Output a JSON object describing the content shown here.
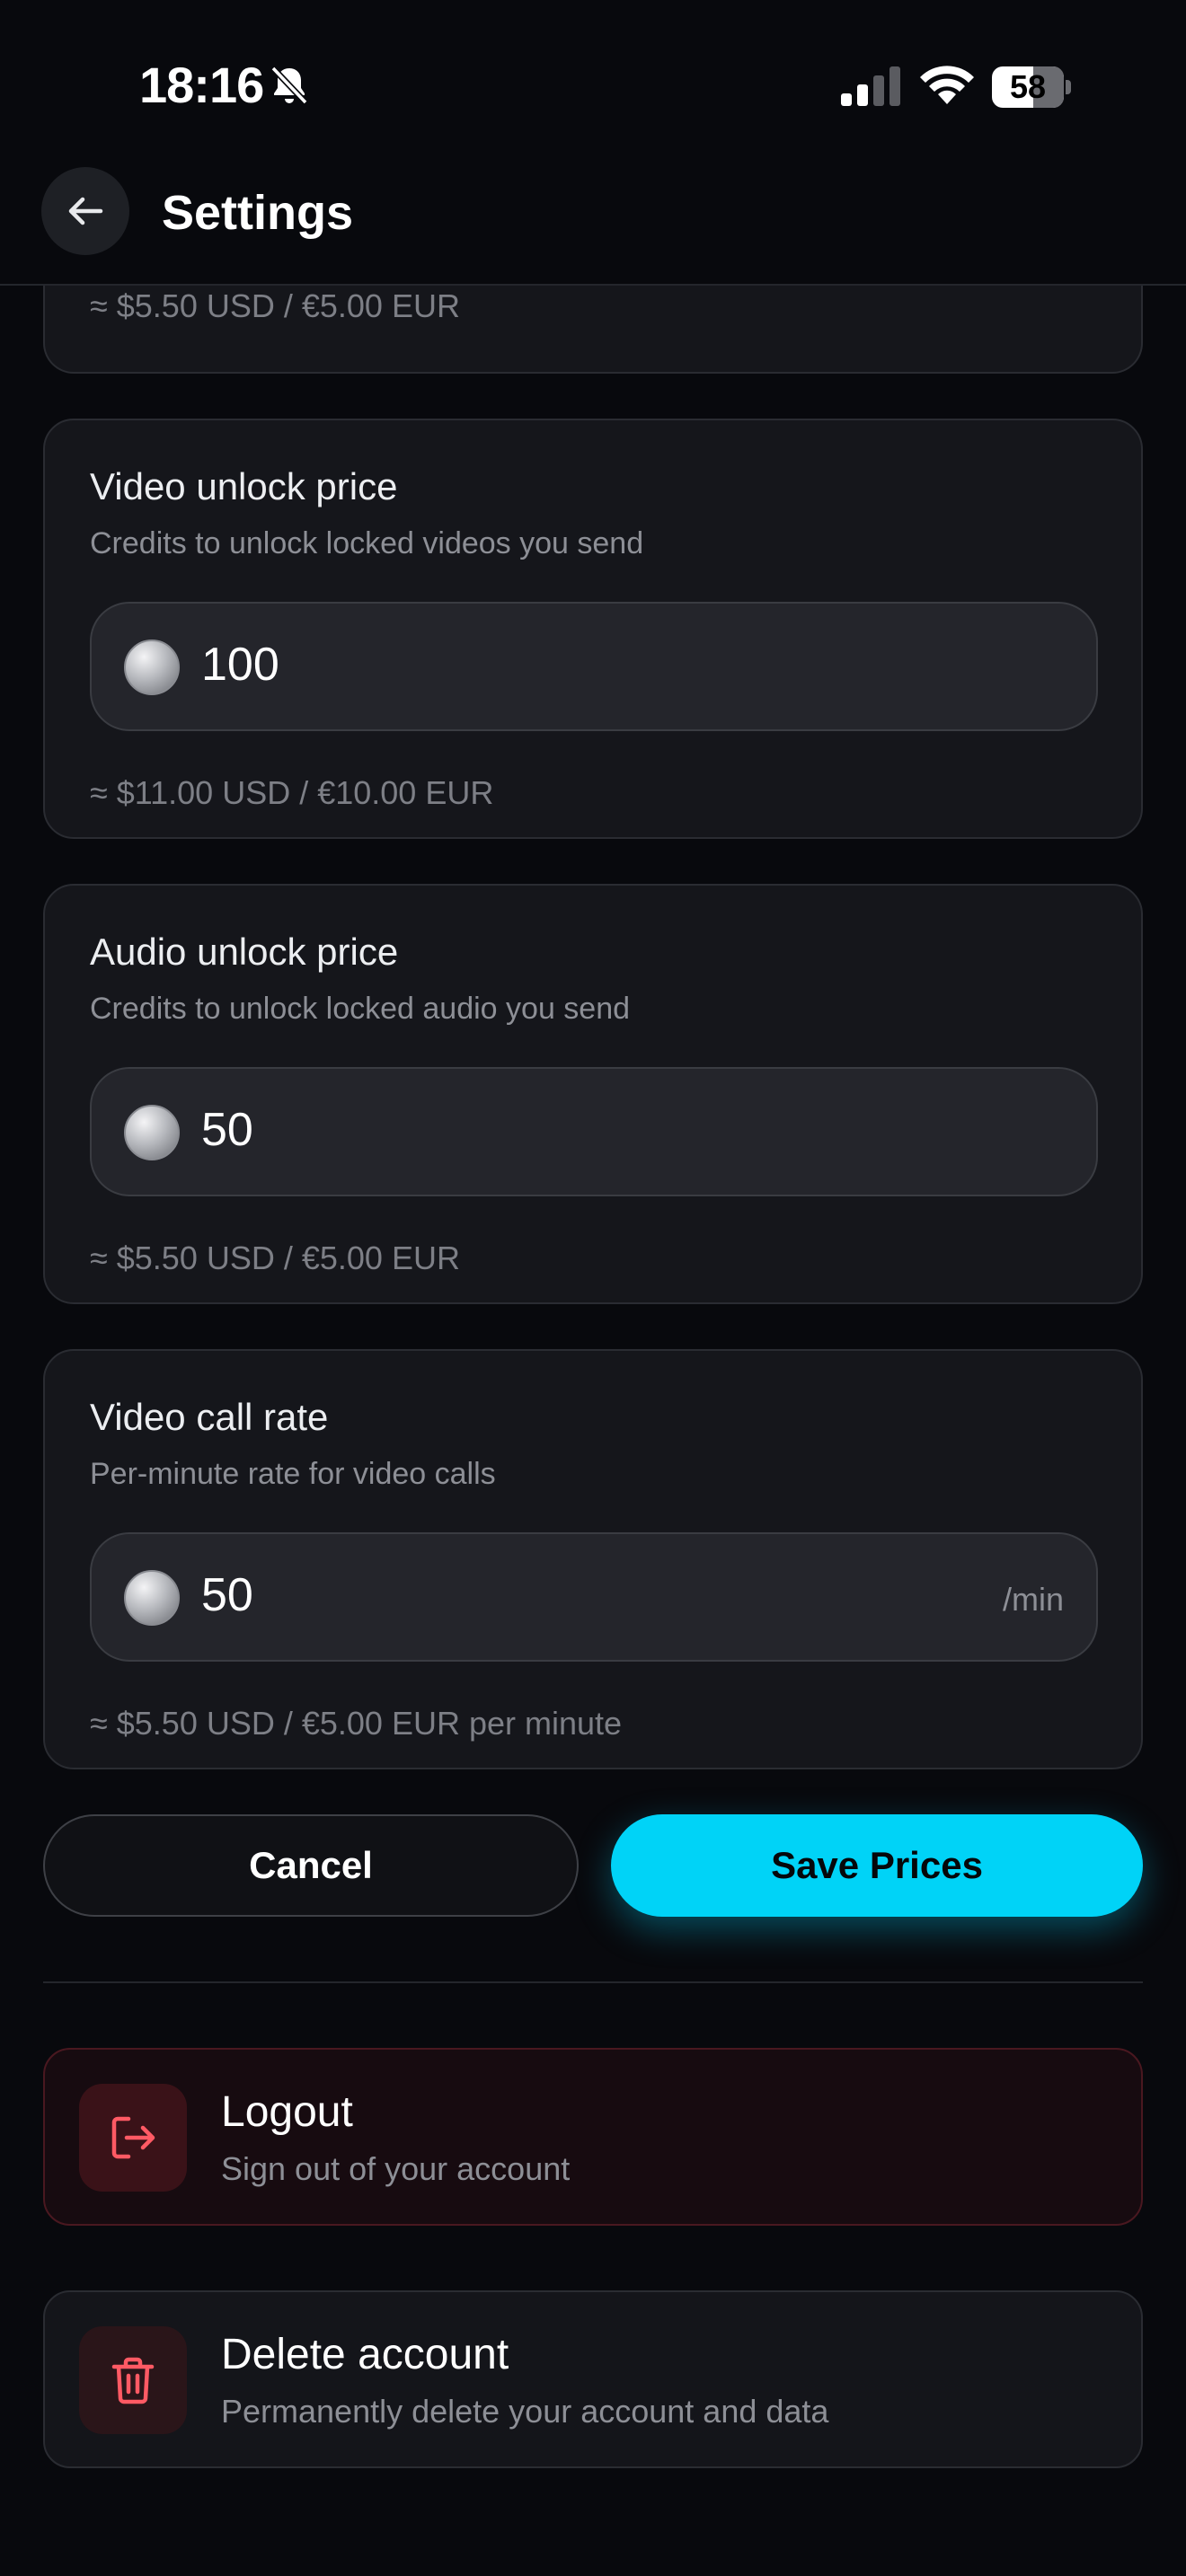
{
  "status_bar": {
    "time": "18:16",
    "battery_level": "58",
    "icons": [
      "bell-muted-icon",
      "signal-icon",
      "wifi-icon",
      "battery-icon"
    ]
  },
  "header": {
    "title": "Settings",
    "back_icon": "arrow-left-icon"
  },
  "partial_card": {
    "conversion": "≈ $5.50 USD / €5.00 EUR"
  },
  "cards": [
    {
      "title": "Video unlock price",
      "subtitle": "Credits to unlock locked videos you send",
      "value": "100",
      "suffix": "",
      "conversion": "≈ $11.00 USD / €10.00 EUR"
    },
    {
      "title": "Audio unlock price",
      "subtitle": "Credits to unlock locked audio you send",
      "value": "50",
      "suffix": "",
      "conversion": "≈ $5.50 USD / €5.00 EUR"
    },
    {
      "title": "Video call rate",
      "subtitle": "Per-minute rate for video calls",
      "value": "50",
      "suffix": "/min",
      "conversion": "≈ $5.50 USD / €5.00 EUR per minute"
    }
  ],
  "buttons": {
    "cancel": "Cancel",
    "save": "Save Prices"
  },
  "logout": {
    "title": "Logout",
    "subtitle": "Sign out of your account",
    "icon": "logout-icon"
  },
  "delete_account": {
    "title": "Delete account",
    "subtitle": "Permanently delete your account and data",
    "icon": "trash-icon"
  },
  "colors": {
    "background": "#08090d",
    "card": "#15161b",
    "accent": "#00d3f7",
    "danger": "#ff5a64"
  }
}
